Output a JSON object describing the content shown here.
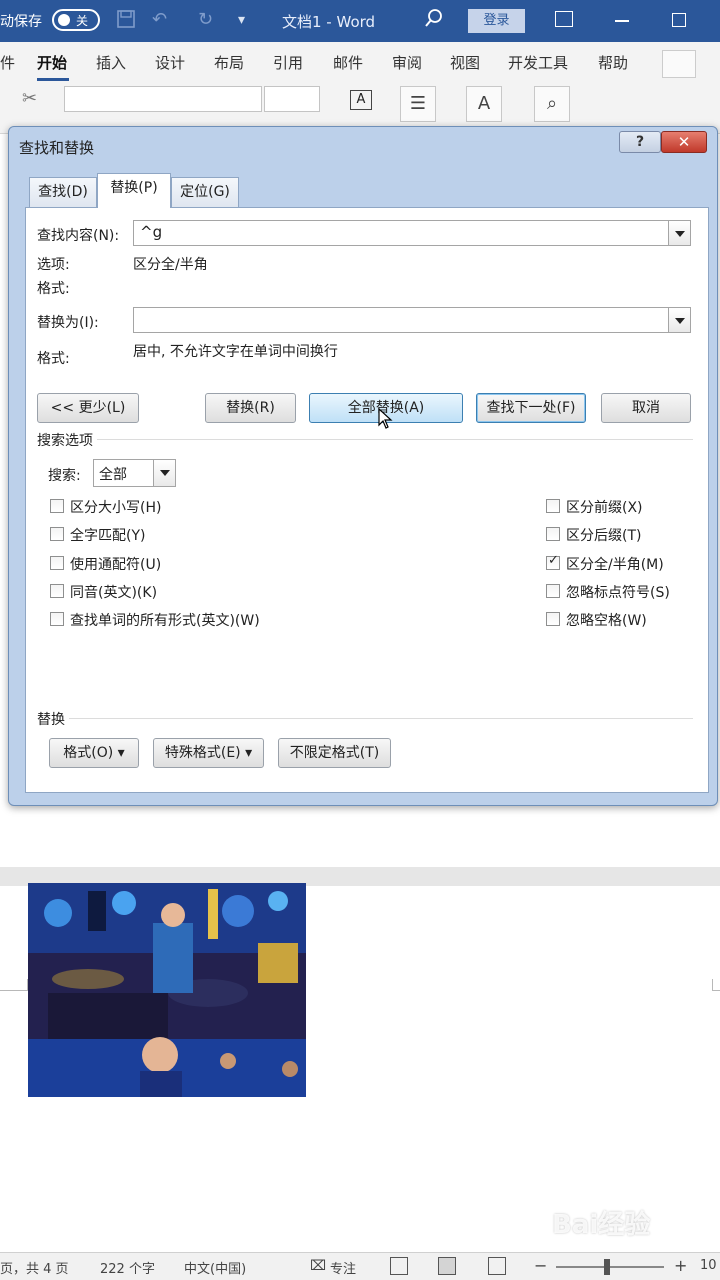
{
  "titlebar": {
    "autosave_label": "动保存",
    "autosave_state": "关",
    "doc_title": "文档1 - Word",
    "login_label": "登录",
    "undo_icon": "undo-icon",
    "redo_icon": "redo-icon",
    "save_icon": "save-icon"
  },
  "ribbon": {
    "tabs": [
      {
        "label": "件"
      },
      {
        "label": "开始"
      },
      {
        "label": "插入"
      },
      {
        "label": "设计"
      },
      {
        "label": "布局"
      },
      {
        "label": "引用"
      },
      {
        "label": "邮件"
      },
      {
        "label": "审阅"
      },
      {
        "label": "视图"
      },
      {
        "label": "开发工具"
      },
      {
        "label": "帮助"
      }
    ],
    "active_tab": "开始"
  },
  "dialog": {
    "title": "查找和替换",
    "help_label": "?",
    "close_label": "✕",
    "tabs": [
      {
        "label": "查找(D)"
      },
      {
        "label": "替换(P)"
      },
      {
        "label": "定位(G)"
      }
    ],
    "find_label": "查找内容(N):",
    "find_value": "^g",
    "options_label": "选项:",
    "options_value": "区分全/半角",
    "format_label1": "格式:",
    "replace_label": "替换为(I):",
    "replace_value": "",
    "format_label2": "格式:",
    "format_value2": "居中, 不允许文字在单词中间换行",
    "buttons": {
      "less": "<< 更少(L)",
      "replace": "替换(R)",
      "replace_all": "全部替换(A)",
      "find_next": "查找下一处(F)",
      "cancel": "取消"
    },
    "search_options_label": "搜索选项",
    "search_label": "搜索:",
    "search_value": "全部",
    "checkboxes_left": [
      {
        "label": "区分大小写(H)",
        "checked": false
      },
      {
        "label": "全字匹配(Y)",
        "checked": false
      },
      {
        "label": "使用通配符(U)",
        "checked": false
      },
      {
        "label": "同音(英文)(K)",
        "checked": false
      },
      {
        "label": "查找单词的所有形式(英文)(W)",
        "checked": false
      }
    ],
    "checkboxes_right": [
      {
        "label": "区分前缀(X)",
        "checked": false
      },
      {
        "label": "区分后缀(T)",
        "checked": false
      },
      {
        "label": "区分全/半角(M)",
        "checked": true
      },
      {
        "label": "忽略标点符号(S)",
        "checked": false
      },
      {
        "label": "忽略空格(W)",
        "checked": false
      }
    ],
    "replace_section_label": "替换",
    "format_button": "格式(O) ▾",
    "special_button": "特殊格式(E) ▾",
    "no_format_button": "不限定格式(T)"
  },
  "statusbar": {
    "page": "页，共 4 页",
    "words": "222 个字",
    "language": "中文(中国)",
    "focus": "专注",
    "zoom_minus": "−",
    "zoom_plus": "+",
    "zoom": "10"
  },
  "watermark": "Bai经验",
  "colors": {
    "titlebar": "#2b579a",
    "dialog_frame": "#bcd0ea",
    "close_button": "#c0392b"
  }
}
